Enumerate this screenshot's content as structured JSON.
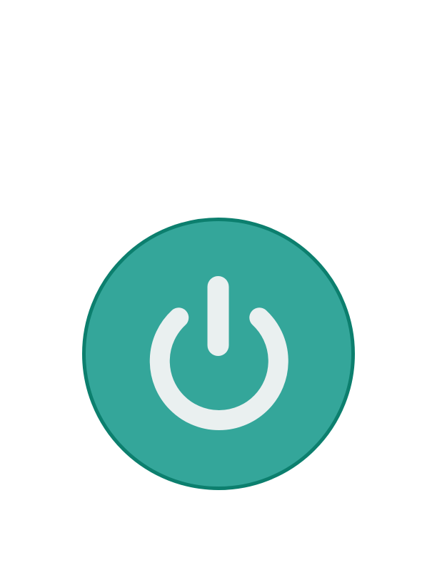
{
  "power_button": {
    "icon": "power-icon",
    "state": "off"
  },
  "colors": {
    "background": "#ffffff",
    "button_fill": "#34a69a",
    "button_border": "#0c7f6e",
    "icon_stroke": "#eaf0f0"
  }
}
